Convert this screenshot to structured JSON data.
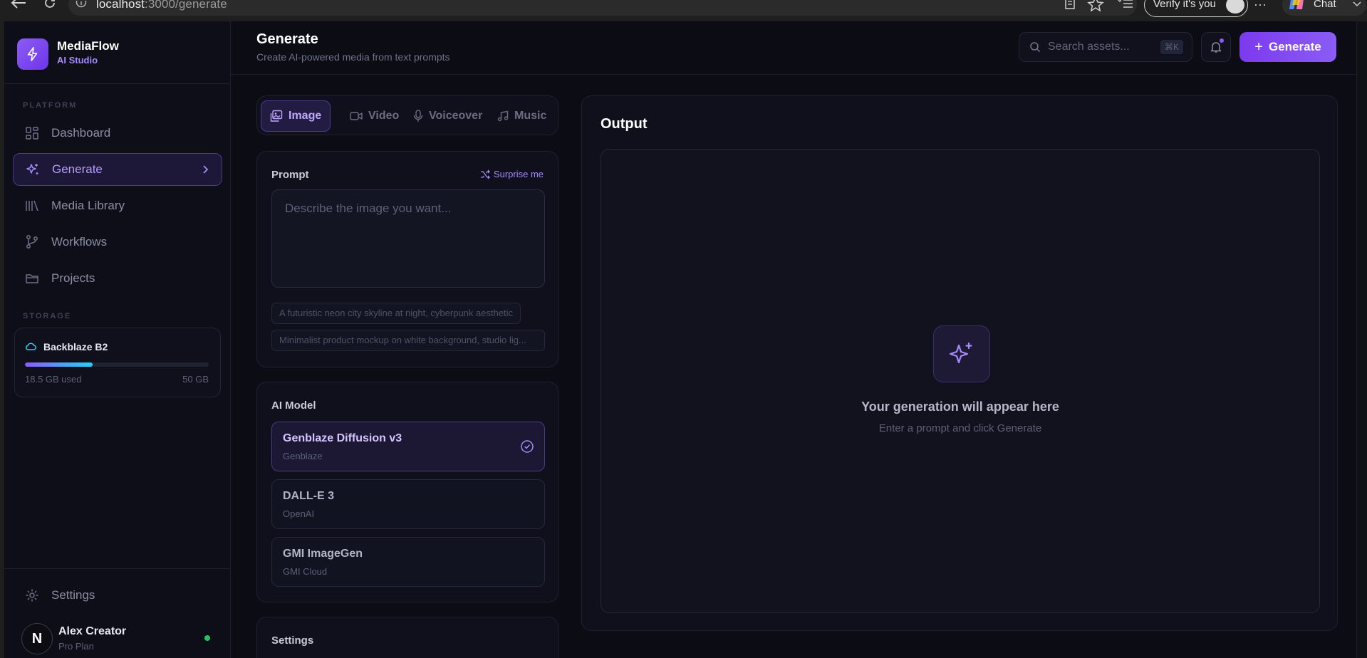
{
  "browser": {
    "url_host": "localhost",
    "url_rest": ":3000/generate",
    "verify_label": "Verify it's you",
    "chat_label": "Chat"
  },
  "brand": {
    "name": "MediaFlow",
    "subtitle": "AI Studio"
  },
  "sidebar": {
    "platform_label": "PLATFORM",
    "items": [
      {
        "label": "Dashboard",
        "icon": "grid-icon",
        "active": false
      },
      {
        "label": "Generate",
        "icon": "sparkles-icon",
        "active": true
      },
      {
        "label": "Media Library",
        "icon": "library-icon",
        "active": false
      },
      {
        "label": "Workflows",
        "icon": "git-branch-icon",
        "active": false
      },
      {
        "label": "Projects",
        "icon": "folder-icon",
        "active": false
      }
    ],
    "storage_label": "STORAGE",
    "storage": {
      "provider": "Backblaze B2",
      "used": "18.5 GB used",
      "capacity": "50 GB",
      "used_fraction": 0.37
    },
    "settings_label": "Settings",
    "user": {
      "initial": "N",
      "name": "Alex Creator",
      "plan": "Pro Plan",
      "online": true
    }
  },
  "header": {
    "title": "Generate",
    "subtitle": "Create AI-powered media from text prompts",
    "search_placeholder": "Search assets...",
    "search_shortcut": "⌘K",
    "generate_label": "Generate"
  },
  "type_tabs": [
    {
      "label": "Image",
      "icon": "image-icon",
      "active": true
    },
    {
      "label": "Video",
      "icon": "video-icon",
      "active": false
    },
    {
      "label": "Voiceover",
      "icon": "mic-icon",
      "active": false
    },
    {
      "label": "Music",
      "icon": "music-icon",
      "active": false
    }
  ],
  "prompt": {
    "label": "Prompt",
    "surprise_label": "Surprise me",
    "placeholder": "Describe the image you want...",
    "value": "",
    "suggestions": [
      "A futuristic neon city skyline at night, cyberpunk aesthetic",
      "Minimalist product mockup on white background, studio lig..."
    ]
  },
  "models": {
    "label": "AI Model",
    "items": [
      {
        "name": "Genblaze Diffusion v3",
        "vendor": "Genblaze",
        "selected": true
      },
      {
        "name": "DALL-E 3",
        "vendor": "OpenAI",
        "selected": false
      },
      {
        "name": "GMI ImageGen",
        "vendor": "GMI Cloud",
        "selected": false
      }
    ]
  },
  "settings_section": {
    "label": "Settings"
  },
  "output": {
    "title": "Output",
    "empty_title": "Your generation will appear here",
    "empty_subtitle": "Enter a prompt and click Generate"
  },
  "colors": {
    "accent": "#8b5cf6",
    "accent_light": "#a78bfa",
    "storage_gradient_end": "#22d3ee",
    "status_online": "#22c55e",
    "background": "#0b0c14"
  }
}
